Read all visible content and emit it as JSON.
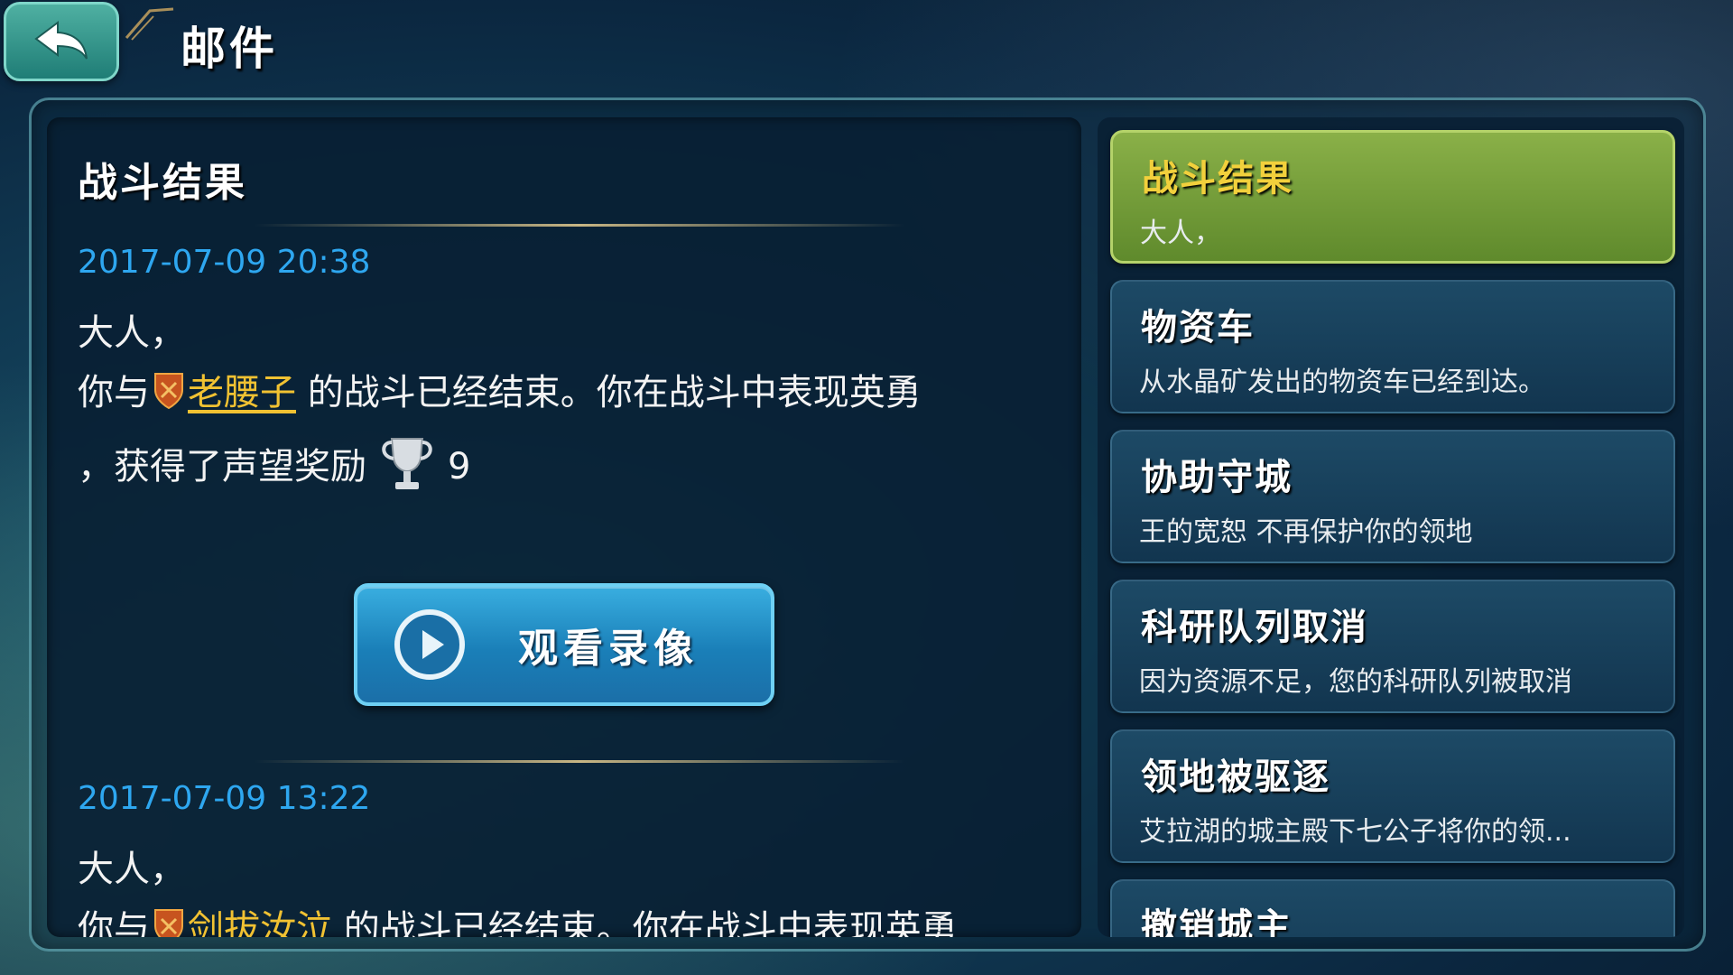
{
  "header": {
    "title": "邮件"
  },
  "content": {
    "title": "战斗结果",
    "battle_button_label": "观看录像",
    "entries": [
      {
        "timestamp": "2017-07-09 20:38",
        "greeting": "大人，",
        "line1_prefix": "你与",
        "opponent": "老腰子",
        "line1_suffix": " 的战斗已经结束。你在战斗中表现英勇",
        "line2_prefix": "，获得了声望奖励",
        "reward_value": "9"
      },
      {
        "timestamp": "2017-07-09 13:22",
        "greeting": "大人，",
        "line1_prefix": "你与",
        "opponent": "剑拔汝泣",
        "line1_suffix": " 的战斗已经结束。你在战斗中表现英勇"
      }
    ]
  },
  "mail_list": [
    {
      "title": "战斗结果",
      "preview": "大人，",
      "active": true
    },
    {
      "title": "物资车",
      "preview": "从水晶矿发出的物资车已经到达。"
    },
    {
      "title": "协助守城",
      "preview": "王的宽恕 不再保护你的领地"
    },
    {
      "title": "科研队列取消",
      "preview": "因为资源不足，您的科研队列被取消"
    },
    {
      "title": "领地被驱逐",
      "preview": "艾拉湖的城主殿下七公子将你的领..."
    },
    {
      "title": "撤销城主",
      "preview": ""
    }
  ],
  "colors": {
    "timestamp": "#2ea7f0",
    "player_name": "#f1c232",
    "active_item": "#7aa23c",
    "button": "#2a93cc"
  },
  "icons": {
    "back": "back-arrow-icon",
    "play": "play-icon",
    "trophy": "trophy-icon",
    "guild": "guild-shield-icon"
  }
}
